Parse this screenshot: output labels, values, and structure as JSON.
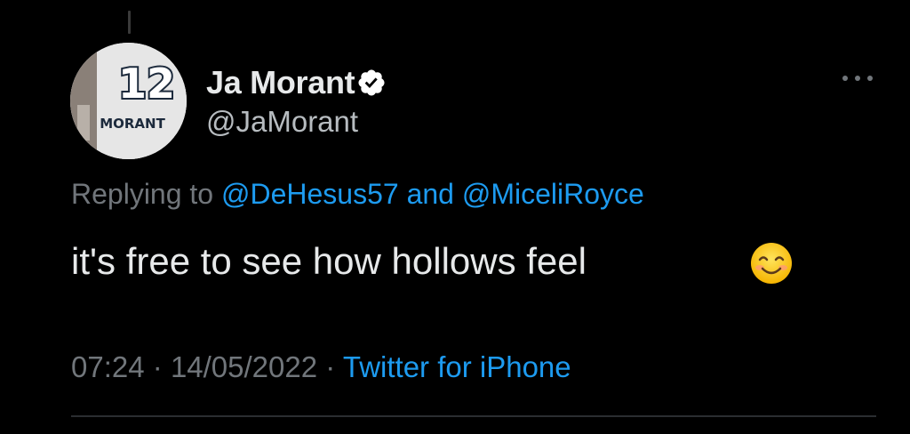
{
  "tweet": {
    "author": {
      "display_name": "Ja Morant",
      "handle": "@JaMorant",
      "verified": true,
      "avatar": {
        "icon": "avatar-photo",
        "jersey_number": "12",
        "jersey_name": "MORANT"
      }
    },
    "reply": {
      "prefix": "Replying to",
      "mentions": [
        "@DeHesus57",
        "@MiceliRoyce"
      ],
      "joiner": "and"
    },
    "text": "it's free to see how hollows feel",
    "emoji": "smiling-face-with-smiling-eyes",
    "meta": {
      "time": "07:24",
      "separator": "·",
      "date": "14/05/2022",
      "source": "Twitter for iPhone"
    }
  },
  "icons": {
    "verified": "verified-badge-icon",
    "more": "more-options-icon"
  },
  "colors": {
    "background": "#000000",
    "primary_text": "#e7e9ea",
    "secondary_text": "#71767b",
    "accent": "#1d9bf0"
  }
}
